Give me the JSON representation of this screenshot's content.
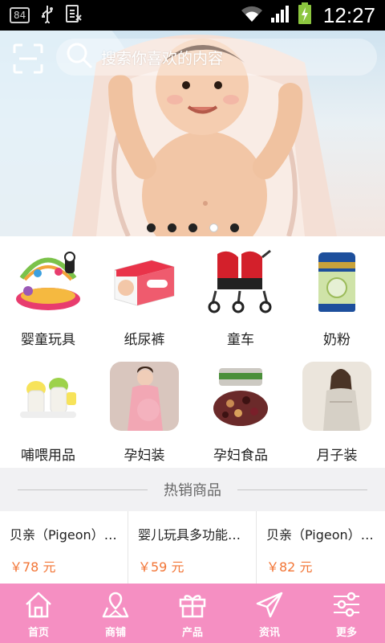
{
  "status_bar": {
    "badge": "84",
    "time": "12:27"
  },
  "header": {
    "search_placeholder": "搜索你喜欢的内容"
  },
  "banner": {
    "slide_count": 5,
    "active_index": 3
  },
  "categories": [
    {
      "label": "婴童玩具",
      "icon": "baby-play-gym"
    },
    {
      "label": "纸尿裤",
      "icon": "diaper-box"
    },
    {
      "label": "童车",
      "icon": "stroller"
    },
    {
      "label": "奶粉",
      "icon": "milk-powder-can"
    },
    {
      "label": "哺喂用品",
      "icon": "feeding-supplies"
    },
    {
      "label": "孕妇装",
      "icon": "maternity-dress"
    },
    {
      "label": "孕妇食品",
      "icon": "maternity-food"
    },
    {
      "label": "月子装",
      "icon": "postpartum-wear"
    }
  ],
  "hot": {
    "title": "热销商品",
    "products": [
      {
        "name": "贝亲（Pigeon）宽口径奶瓶",
        "price": "￥78 元"
      },
      {
        "name": "婴儿玩具多功能健身架",
        "price": "￥59 元"
      },
      {
        "name": "贝亲（Pigeon）奶嘴",
        "price": "￥82 元"
      }
    ]
  },
  "nav": [
    {
      "label": "首页",
      "icon": "home-icon"
    },
    {
      "label": "商铺",
      "icon": "shop-icon"
    },
    {
      "label": "产品",
      "icon": "gift-icon"
    },
    {
      "label": "资讯",
      "icon": "send-icon"
    },
    {
      "label": "更多",
      "icon": "sliders-icon"
    }
  ],
  "colors": {
    "nav_bg": "#f58fc2",
    "price": "#f27536",
    "section_bg": "#f1f1f3"
  }
}
